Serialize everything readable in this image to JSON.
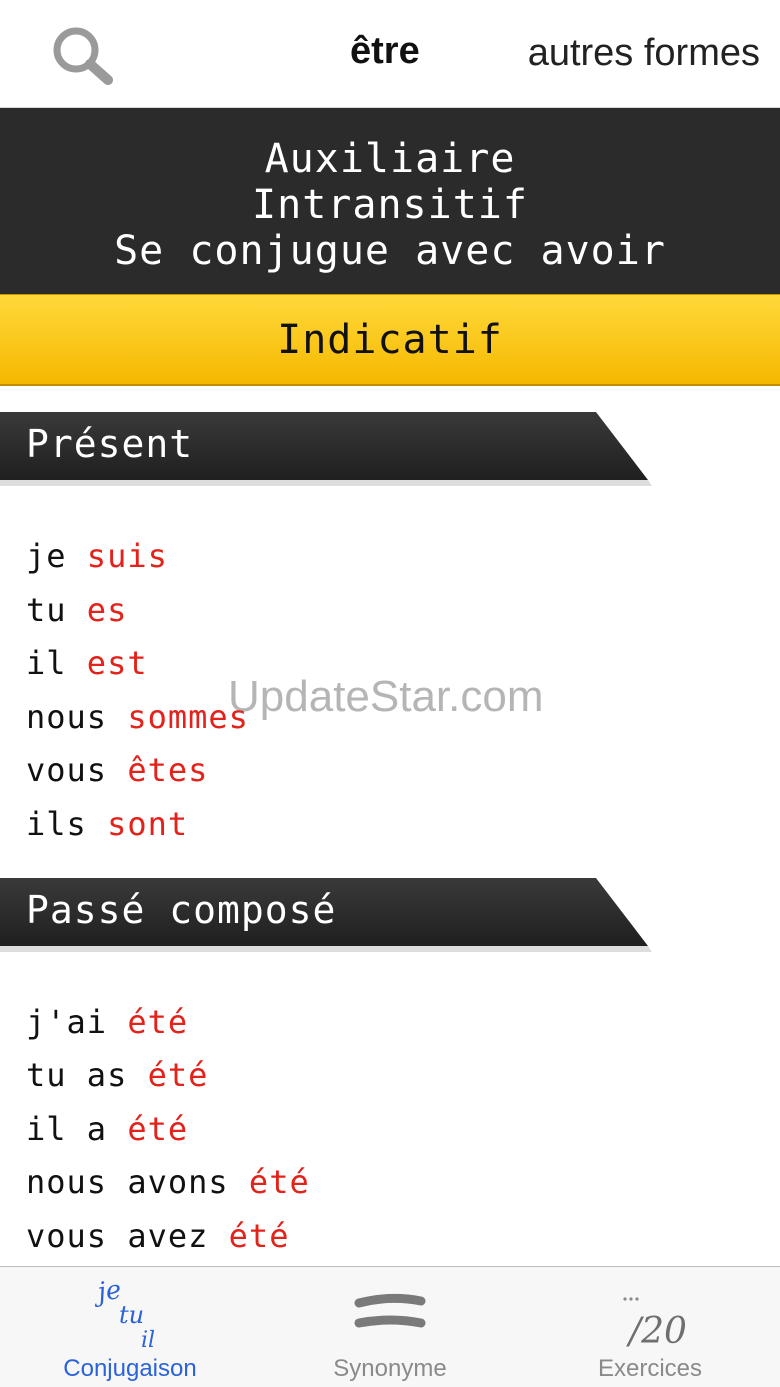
{
  "header": {
    "verb": "être",
    "other_forms": "autres formes"
  },
  "info": {
    "lines": [
      "Auxiliaire",
      "Intransitif",
      "Se conjugue avec avoir"
    ]
  },
  "mood": "Indicatif",
  "tenses": [
    {
      "title": "Présent",
      "rows": [
        {
          "pronoun": "je ",
          "form": "suis"
        },
        {
          "pronoun": "tu ",
          "form": "es"
        },
        {
          "pronoun": "il ",
          "form": "est"
        },
        {
          "pronoun": "nous ",
          "form": "sommes"
        },
        {
          "pronoun": "vous ",
          "form": "êtes"
        },
        {
          "pronoun": "ils ",
          "form": "sont"
        }
      ]
    },
    {
      "title": "Passé composé",
      "rows": [
        {
          "pronoun": "j'ai ",
          "form": "été"
        },
        {
          "pronoun": "tu as ",
          "form": "été"
        },
        {
          "pronoun": "il a ",
          "form": "été"
        },
        {
          "pronoun": "nous avons ",
          "form": "été"
        },
        {
          "pronoun": "vous avez ",
          "form": "été"
        }
      ]
    }
  ],
  "watermark": "UpdateStar.com",
  "tabs": [
    {
      "label": "Conjugaison",
      "icon": "conjugaison-icon",
      "active": true
    },
    {
      "label": "Synonyme",
      "icon": "synonyme-icon",
      "active": false
    },
    {
      "label": "Exercices",
      "icon": "exercices-icon",
      "active": false
    }
  ],
  "icon_texts": {
    "conj_je": "je",
    "conj_tu": "tu",
    "conj_il": "il",
    "exercices_score": "/20"
  },
  "colors": {
    "form": "#e3231b",
    "tab_active": "#2a63d9",
    "tab_inactive": "#8a8a8a",
    "info_band": "#2b2b2b",
    "mood_bar": "#f5b800"
  }
}
